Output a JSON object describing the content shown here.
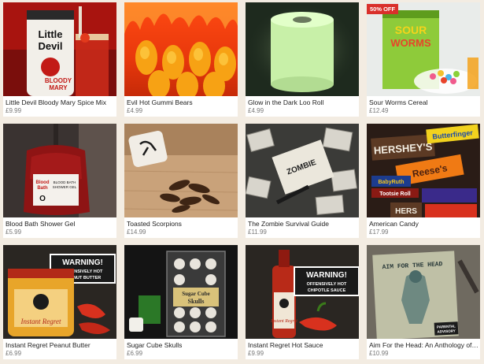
{
  "products": [
    {
      "name": "Little Devil Bloody Mary Spice Mix",
      "price": "£9.99",
      "image_text": [
        "Little",
        "Devil",
        "BLOODY",
        "MARY"
      ]
    },
    {
      "name": "Evil Hot Gummi Bears",
      "price": "£4.99"
    },
    {
      "name": "Glow in the Dark Loo Roll",
      "price": "£4.99"
    },
    {
      "name": "Sour Worms Cereal",
      "price": "£12.49",
      "badge": "50% OFF",
      "image_text": [
        "SOUR",
        "WORMS"
      ]
    },
    {
      "name": "Blood Bath Shower Gel",
      "price": "£5.99",
      "image_text": [
        "Blood",
        "Bath",
        "BLOOD BATH",
        "SHOWER GEL",
        "O"
      ]
    },
    {
      "name": "Toasted Scorpions",
      "price": "£14.99"
    },
    {
      "name": "The Zombie Survival Guide",
      "price": "£11.99",
      "image_text": [
        "ZOMBIE"
      ]
    },
    {
      "name": "American Candy",
      "price": "£17.99",
      "image_text": [
        "HERSHEY'S",
        "Butterfinger",
        "Reese's",
        "BabyRuth",
        "Tootsie Roll",
        "HERS"
      ]
    },
    {
      "name": "Instant Regret Peanut Butter",
      "price": "£6.99",
      "image_text": [
        "WARNING!",
        "OFFENSIVELY HOT",
        "PEANUT BUTTER",
        "Instant Regret"
      ]
    },
    {
      "name": "Sugar Cube Skulls",
      "price": "£6.99",
      "image_text": [
        "Sugar Cube",
        "Skulls"
      ]
    },
    {
      "name": "Instant Regret Hot Sauce",
      "price": "£9.99",
      "image_text": [
        "WARNING!",
        "OFFENSIVELY HOT",
        "CHIPOTLE SAUCE",
        "Instant Regret"
      ]
    },
    {
      "name": "Aim For the Head: An Anthology of Zom...",
      "price": "£10.99",
      "image_text": [
        "AIM FOR THE HEAD",
        "PARENTAL",
        "ADVISORY"
      ]
    }
  ],
  "colors": {
    "page_bg": "#f3ece2",
    "badge_bg": "#d9302b",
    "price_text": "#777777"
  }
}
